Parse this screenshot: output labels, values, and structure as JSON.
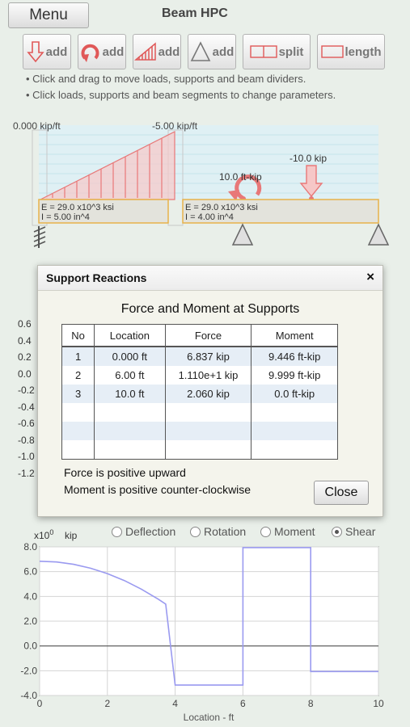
{
  "header": {
    "menu_label": "Menu",
    "title": "Beam HPC"
  },
  "toolbar": {
    "point_load": "add",
    "moment": "add",
    "distributed": "add",
    "support": "add",
    "split": "split",
    "length": "length"
  },
  "instructions": [
    "• Click and drag to move loads, supports and beam dividers.",
    "• Click loads, supports and beam segments to change parameters."
  ],
  "diagram": {
    "dist_start_label": "0.000 kip/ft",
    "dist_end_label": "-5.00 kip/ft",
    "moment_label": "10.0 ft-kip",
    "point_label": "-10.0 kip",
    "segment1_E": "E = 29.0 x10^3 ksi",
    "segment1_I": "I = 5.00 in^4",
    "segment2_E": "E = 29.0 x10^3 ksi",
    "segment2_I": "I = 4.00 in^4",
    "load_color": "#f08a8a",
    "beam_color": "#e7b24a"
  },
  "behind_axis_ticks": [
    "0.6",
    "0.4",
    "0.2",
    "0.0",
    "-0.2",
    "-0.4",
    "-0.6",
    "-0.8",
    "-1.0",
    "-1.2"
  ],
  "dialog": {
    "title": "Support Reactions",
    "close_icon": "×",
    "heading": "Force and Moment at Supports",
    "columns": [
      "No",
      "Location",
      "Force",
      "Moment"
    ],
    "rows": [
      {
        "no": "1",
        "location": "0.000 ft",
        "force": "6.837 kip",
        "moment": "9.446 ft-kip"
      },
      {
        "no": "2",
        "location": "6.00 ft",
        "force": "1.110e+1 kip",
        "moment": "9.999 ft-kip"
      },
      {
        "no": "3",
        "location": "10.0 ft",
        "force": "2.060 kip",
        "moment": "0.0 ft-kip"
      }
    ],
    "note_force": "Force is positive upward",
    "note_moment": "Moment is positive counter-clockwise",
    "close_label": "Close"
  },
  "plot_modes": {
    "deflection": "Deflection",
    "rotation": "Rotation",
    "moment": "Moment",
    "shear": "Shear",
    "selected": "shear"
  },
  "chart_data": {
    "type": "line",
    "title": "",
    "xlabel": "Location - ft",
    "ylabel": "kip",
    "y_multiplier_label": "x10",
    "y_multiplier_exp": "0",
    "xlim": [
      0,
      10
    ],
    "ylim": [
      -4.0,
      8.0
    ],
    "x_ticks": [
      0,
      2,
      4,
      6,
      8,
      10
    ],
    "y_ticks": [
      8.0,
      6.0,
      4.0,
      2.0,
      0.0,
      -2.0,
      -4.0
    ],
    "x_tick_labels": [
      "0",
      "2",
      "4",
      "6",
      "8",
      "10"
    ],
    "y_tick_labels": [
      "8.0",
      "6.0",
      "4.0",
      "2.0",
      "0.0",
      "-2.0",
      "-4.0"
    ],
    "grid": true,
    "line_color": "#9a9af0",
    "series": [
      {
        "points": [
          [
            0,
            6.84
          ],
          [
            0.5,
            6.78
          ],
          [
            1.0,
            6.59
          ],
          [
            1.5,
            6.28
          ],
          [
            2.0,
            5.84
          ],
          [
            2.5,
            5.28
          ],
          [
            3.0,
            4.59
          ],
          [
            3.5,
            3.78
          ],
          [
            3.72,
            3.38
          ],
          [
            4.0,
            -3.16
          ],
          [
            6.0,
            -3.16
          ],
          [
            6.0,
            7.94
          ],
          [
            8.0,
            7.94
          ],
          [
            8.0,
            -2.06
          ],
          [
            10.0,
            -2.06
          ]
        ]
      }
    ]
  }
}
